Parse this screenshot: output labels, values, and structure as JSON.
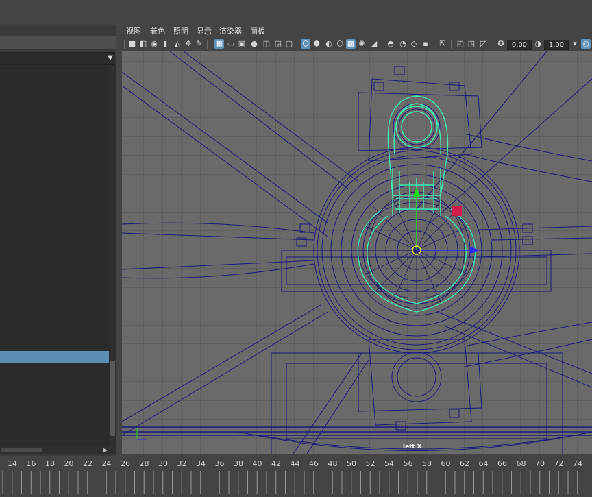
{
  "menubar": {
    "items": [
      "视图",
      "着色",
      "照明",
      "显示",
      "渲染器",
      "面板"
    ]
  },
  "toolbar": {
    "icons": [
      "camera-icon",
      "camera-attr-icon",
      "bookmark-icon",
      "bookmark-icon-2",
      "image-plane-icon",
      "2d-pan-icon",
      "grease-pencil-icon",
      "grid-icon",
      "film-gate-icon",
      "resolution-gate-icon",
      "gate-mask-icon",
      "field-chart-icon",
      "safe-action-icon",
      "safe-title-icon",
      "wireframe-icon",
      "smooth-shade-icon",
      "shade-default-icon",
      "bounding-box-icon",
      "xray-icon",
      "lights-icon",
      "shadows-icon",
      "ambient-occlusion-icon",
      "motion-blur-icon",
      "antialias-icon",
      "depth-of-field-icon",
      "isolate-icon",
      "xray-joints-icon",
      "xray-active-icon",
      "backface-icon",
      "exposure-icon",
      "gamma-icon",
      "color-manage-icon"
    ],
    "exposure_value": "0.00",
    "gamma_value": "1.00",
    "color_space_label": "sR"
  },
  "viewport": {
    "view_label": "left X"
  },
  "timeline": {
    "ticks": [
      "14",
      "16",
      "18",
      "20",
      "22",
      "24",
      "26",
      "28",
      "30",
      "32",
      "34",
      "36",
      "38",
      "40",
      "42",
      "44",
      "46",
      "48",
      "50",
      "52",
      "54",
      "56",
      "58",
      "60",
      "62",
      "64",
      "66",
      "68",
      "70",
      "72",
      "74"
    ]
  },
  "colors": {
    "wire_dark": "#1a1a7a",
    "wire_highlight": "#3ef0b4",
    "grid": "#555555",
    "selection": "#5c8db3",
    "manip_y": "#18e018",
    "manip_x": "#2a2aff",
    "manip_center": "#ffff30",
    "manip_plane": "#d01c4c"
  }
}
